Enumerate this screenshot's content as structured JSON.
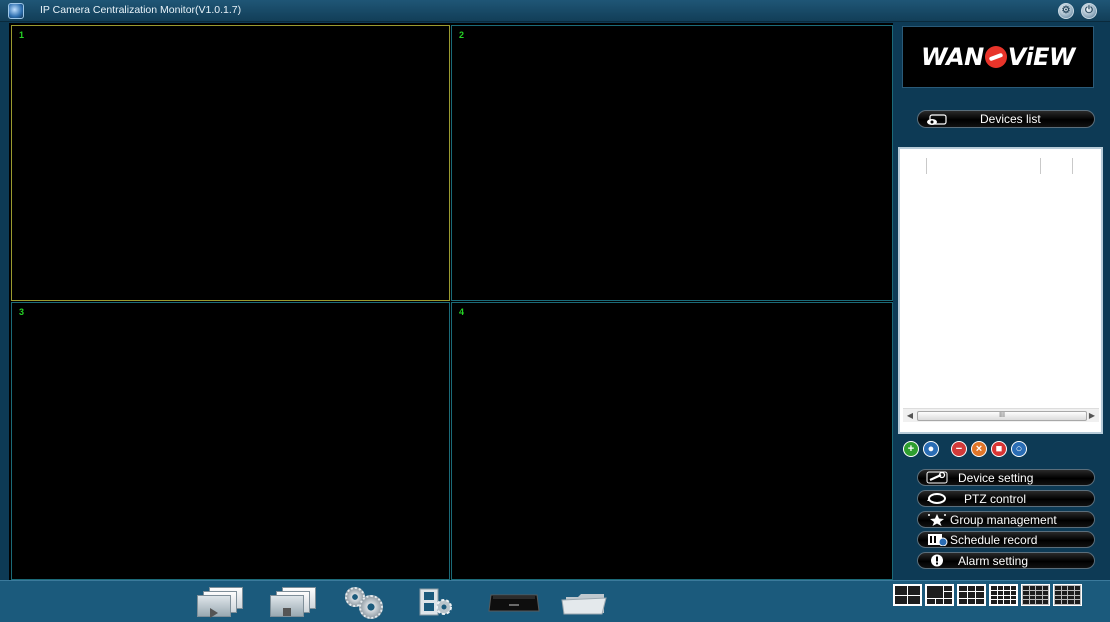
{
  "window": {
    "title": "IP Camera Centralization Monitor(V1.0.1.7)",
    "title_buttons": [
      {
        "name": "settings",
        "icon": "gear-icon"
      },
      {
        "name": "power",
        "icon": "power-icon"
      }
    ]
  },
  "video_grid": {
    "cells": [
      {
        "number": "1",
        "active": true
      },
      {
        "number": "2",
        "active": false
      },
      {
        "number": "3",
        "active": false
      },
      {
        "number": "4",
        "active": false
      }
    ],
    "active_border_color": "#9a9a30",
    "border_color": "#1b6a78"
  },
  "right_panel": {
    "logo_text_left": "WAN",
    "logo_text_right": "ViEW",
    "devices_list_label": "Devices list",
    "device_tree": {
      "scrollbar_thumb_glyph": "III"
    },
    "tool_icons": [
      {
        "icon": "add-icon",
        "color": "#2f9e2f",
        "glyph": "+"
      },
      {
        "icon": "search-device-icon",
        "color": "#2a6db5",
        "glyph": "●"
      },
      {
        "icon": "delete-icon",
        "color": "#d23a3a",
        "glyph": "−"
      },
      {
        "icon": "remove-icon",
        "color": "#e0762a",
        "glyph": "×"
      },
      {
        "icon": "stop-icon",
        "color": "#d83535",
        "glyph": "■"
      },
      {
        "icon": "refresh-icon",
        "color": "#2a6db5",
        "glyph": "○"
      }
    ],
    "menu": {
      "device_setting": "Device setting",
      "ptz_control": "PTZ control",
      "group_management": "Group management",
      "schedule_record": "Schedule record",
      "alarm_setting": "Alarm setting"
    }
  },
  "bottom_toolbar": {
    "tools": [
      {
        "name": "play-all",
        "icon": "play-all-icon"
      },
      {
        "name": "stop-all",
        "icon": "stop-all-icon"
      },
      {
        "name": "system-settings",
        "icon": "gear-icon"
      },
      {
        "name": "playback",
        "icon": "film-gear-icon"
      },
      {
        "name": "dvr",
        "icon": "dvr-icon"
      },
      {
        "name": "record-folder",
        "icon": "folder-icon"
      }
    ],
    "layout_options": [
      "1x1",
      "1+3",
      "3x3",
      "4x4",
      "1+7",
      "1+12"
    ]
  },
  "colors": {
    "frame": "#0d3a55",
    "toolbar": "#1b5a7c",
    "cell_number": "#25d325"
  }
}
